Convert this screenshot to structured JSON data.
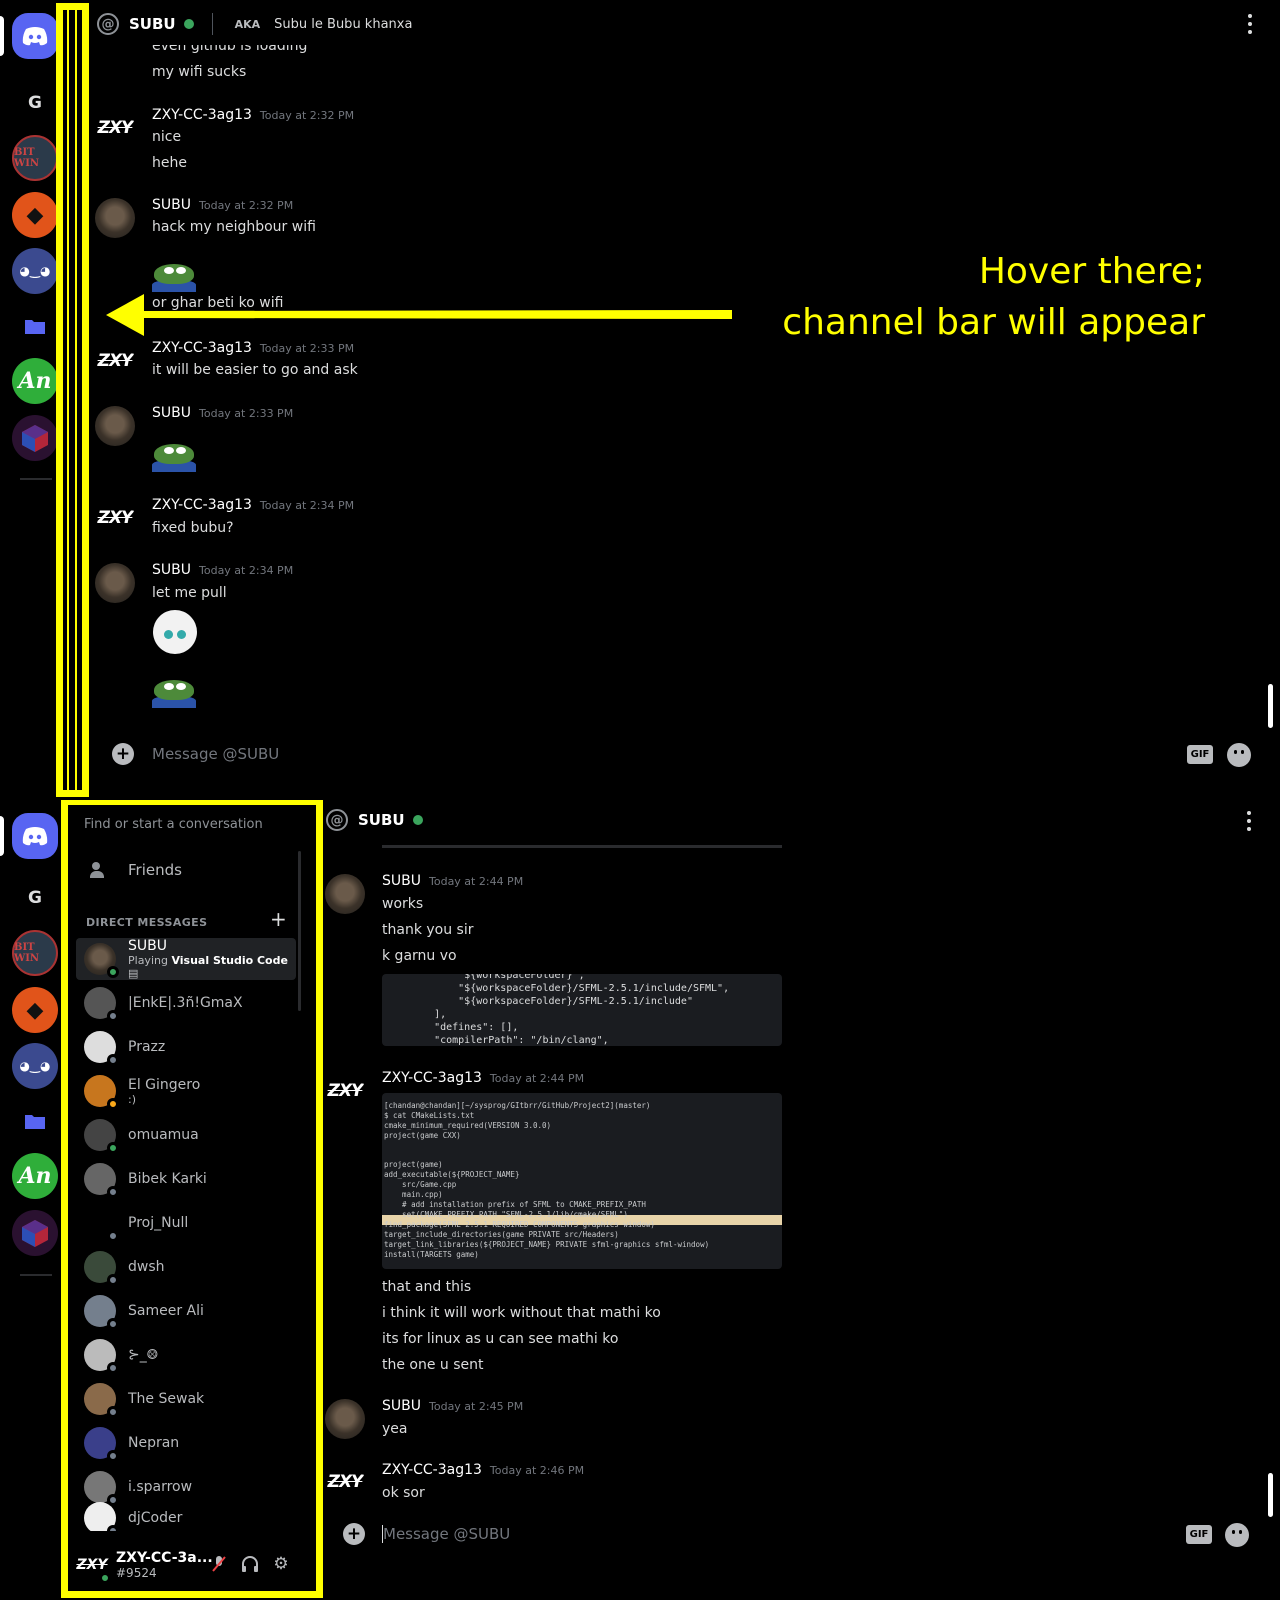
{
  "servers": [
    {
      "name": "discord-home",
      "icon": "discord-logo-icon"
    },
    {
      "name": "G"
    },
    {
      "name": "BIT WIN",
      "abbr": "BIT WIN"
    },
    {
      "name": "orange-dragon-server",
      "icon": "dragon-icon"
    },
    {
      "name": "anime-server",
      "icon": "anime-icon"
    },
    {
      "name": "folder",
      "icon": "folder-icon"
    },
    {
      "name": "An",
      "abbr": "An"
    },
    {
      "name": "cube-server",
      "icon": "cube-icon"
    }
  ],
  "top": {
    "header": {
      "name": "SUBU",
      "aka_label": "AKA",
      "aka_name": "Subu le Bubu khanxa"
    },
    "messages": [
      {
        "text": "even github is loading"
      },
      {
        "text": "my wifi sucks"
      },
      {
        "author": "ZXY-CC-3ag13",
        "time": "Today at 2:32 PM",
        "lines": [
          "nice",
          "hehe"
        ]
      },
      {
        "author": "SUBU",
        "time": "Today at 2:32 PM",
        "lines": [
          "hack my neighbour wifi"
        ]
      },
      {
        "text": "or ghar beti ko wifi"
      },
      {
        "author": "ZXY-CC-3ag13",
        "time": "Today at 2:33 PM",
        "lines": [
          "it will be easier to go and ask"
        ]
      },
      {
        "author": "SUBU",
        "time": "Today at 2:33 PM"
      },
      {
        "author": "ZXY-CC-3ag13",
        "time": "Today at 2:34 PM",
        "lines": [
          "fixed bubu?"
        ]
      },
      {
        "author": "SUBU",
        "time": "Today at 2:34 PM",
        "lines": [
          "let me pull"
        ]
      }
    ],
    "input_placeholder": "Message @SUBU",
    "gif_label": "GIF"
  },
  "annotation": {
    "line1": "Hover there;",
    "line2": "channel bar will appear",
    "color": "#ffff00"
  },
  "bottom": {
    "search_placeholder": "Find or start a conversation",
    "friends_label": "Friends",
    "dm_heading": "DIRECT MESSAGES",
    "dms": [
      {
        "name": "SUBU",
        "activity_prefix": "Playing ",
        "activity_bold": "Visual Studio Code",
        "status": "online"
      },
      {
        "name": "|EnkE|.3ñ!GmaX",
        "status": "offline"
      },
      {
        "name": "Prazz",
        "status": "offline"
      },
      {
        "name": "El Gingero",
        "sub": ":)",
        "status": "idle"
      },
      {
        "name": "omuamua",
        "status": "online"
      },
      {
        "name": "Bibek Karki",
        "status": "offline"
      },
      {
        "name": "Proj_Null",
        "status": "offline"
      },
      {
        "name": "dwsh",
        "status": "offline"
      },
      {
        "name": "Sameer Ali",
        "status": "offline"
      },
      {
        "name": "⊱_⨷",
        "status": "offline"
      },
      {
        "name": "The Sewak",
        "status": "offline"
      },
      {
        "name": "Nepran",
        "status": "offline"
      },
      {
        "name": "i.sparrow",
        "status": "offline"
      },
      {
        "name": "djCoder",
        "status": "offline"
      }
    ],
    "user": {
      "name": "ZXY-CC-3a...",
      "tag": "#9524"
    },
    "header": {
      "name": "SUBU"
    },
    "messages": [
      {
        "author": "SUBU",
        "time": "Today at 2:44 PM",
        "lines": [
          "works",
          "thank you sir",
          "k garnu vo"
        ]
      },
      {
        "author": "ZXY-CC-3ag13",
        "time": "Today at 2:44 PM",
        "lines": [
          "that and this",
          "i think it will work without that mathi ko",
          "its for linux as u can see mathi ko",
          "the one u sent"
        ]
      },
      {
        "author": "SUBU",
        "time": "Today at 2:45 PM",
        "lines": [
          "yea"
        ]
      },
      {
        "author": "ZXY-CC-3ag13",
        "time": "Today at 2:46 PM",
        "lines": [
          "ok sor"
        ]
      }
    ],
    "code1": "        \"${workspaceFolder}\",\n        \"${workspaceFolder}/SFML-2.5.1/include/SFML\",\n        \"${workspaceFolder}/SFML-2.5.1/include\"\n    ],\n    \"defines\": [],\n    \"compilerPath\": \"/bin/clang\",",
    "code2": "[chandan@chandan][~/sysprog/GItbrr/GitHub/Project2](master)\n$ cat CMakeLists.txt\ncmake_minimum_required(VERSION 3.0.0)\nproject(game CXX)\n\n\nproject(game)\nadd_executable(${PROJECT_NAME}\n    src/Game.cpp\n    main.cpp)\n    # add installation prefix of SFML to CMAKE_PREFIX_PATH\n    set(CMAKE_PREFIX_PATH \"SFML-2.5.1/lib/cmake/SFML\")\nfind_package(SFML 2.5.1 REQUIRED COMPONENTS graphics window)\ntarget_include_directories(game PRIVATE src/Headers)\ntarget_link_libraries(${PROJECT_NAME} PRIVATE sfml-graphics sfml-window)\ninstall(TARGETS game)",
    "input_placeholder": "Message @SUBU",
    "gif_label": "GIF"
  }
}
